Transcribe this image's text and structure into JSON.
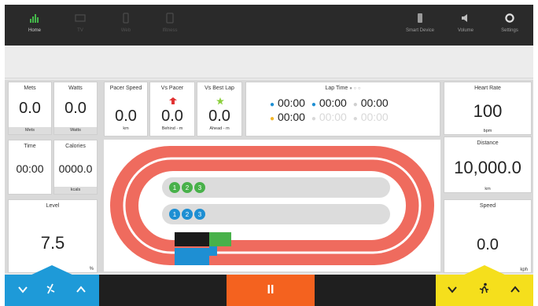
{
  "topbar": {
    "items": [
      {
        "label": "Home",
        "icon": "bars-chart-icon",
        "active": true
      },
      {
        "label": "TV",
        "icon": "tv-icon"
      },
      {
        "label": "Web",
        "icon": "phone-icon"
      },
      {
        "label": "Ifitness",
        "icon": "tablet-icon"
      },
      {
        "label": "Smart Device",
        "icon": "device-icon"
      },
      {
        "label": "Volume",
        "icon": "speaker-icon"
      },
      {
        "label": "Settings",
        "icon": "gear-icon"
      }
    ]
  },
  "metrics": {
    "mets": {
      "title": "Mets",
      "value": "0.0",
      "unit": "Mets"
    },
    "watts": {
      "title": "Watts",
      "value": "0.0",
      "unit": "Watts"
    },
    "time": {
      "title": "Time",
      "value": "00:00"
    },
    "calories": {
      "title": "Calories",
      "value": "0000.0",
      "unit": "kcals"
    },
    "level": {
      "title": "Level",
      "value": "7.5",
      "unit": "%"
    },
    "pacer_speed": {
      "title": "Pacer Speed",
      "value": "0.0",
      "unit": "km"
    },
    "vs_pacer": {
      "title": "Vs Pacer",
      "value": "0.0",
      "unit": "Behind - m"
    },
    "vs_best_lap": {
      "title": "Vs Best Lap",
      "value": "0.0",
      "unit": "Ahead - m"
    },
    "lap_time": {
      "title": "Lap Time",
      "laps": [
        "00:00",
        "00:00",
        "00:00",
        "00:00",
        "00:00",
        "00:00"
      ]
    },
    "heart_rate": {
      "title": "Heart Rate",
      "value": "100",
      "unit": "bpm"
    },
    "distance": {
      "title": "Distance",
      "value": "10,000.0",
      "unit": "km"
    },
    "speed": {
      "title": "Speed",
      "value": "0.0",
      "unit": "kph"
    }
  },
  "track": {
    "green_markers": [
      "1",
      "2",
      "3"
    ],
    "blue_markers": [
      "1",
      "2",
      "3"
    ],
    "colors": {
      "track": "#ef6b5e",
      "lane": "#d9d9d9",
      "green": "#48b14a",
      "blue": "#1e8fd3"
    }
  },
  "controls": {
    "pause_label": "II",
    "colors": {
      "left": "#1e9ad8",
      "right": "#f5df1c",
      "pause": "#f4621f"
    }
  }
}
